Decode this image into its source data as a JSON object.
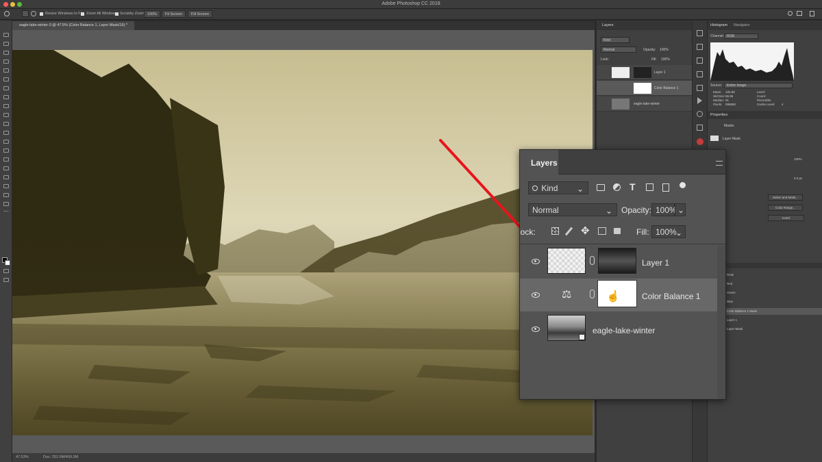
{
  "app": {
    "title": "Adobe Photoshop CC 2018"
  },
  "options_bar": {
    "resize_windows": "Resize Windows to Fit",
    "zoom_all": "Zoom All Windows",
    "scrubby_zoom": "Scrubby Zoom",
    "zoom_100": "100%",
    "fit_screen": "Fit Screen",
    "fill_screen": "Fill Screen"
  },
  "document": {
    "tab_label": "eagle-lake-winter-3 @ 47.5% (Color Balance 1, Layer Mask/16) *",
    "zoom": "47.53%",
    "doc_info": "Doc: 252.9M/409.3M"
  },
  "layers_panel": {
    "title": "Layers",
    "filter": "Kind",
    "blend_mode": "Normal",
    "opacity_label": "Opacity:",
    "opacity_value": "100%",
    "lock_label": "Lock:",
    "fill_label": "Fill:",
    "fill_value": "100%",
    "layers": [
      {
        "name": "Layer 1"
      },
      {
        "name": "Color Balance 1"
      },
      {
        "name": "eagle-lake-winter"
      }
    ]
  },
  "histogram_panel": {
    "tabs": [
      "Histogram",
      "Navigator"
    ],
    "channel_label": "Channel:",
    "channel_value": "RGB",
    "source_label": "Source:",
    "source_value": "Entire Image",
    "stats_left": [
      "Mean:",
      "Std Dev:",
      "Median:",
      "Pixels:"
    ],
    "stats_values": [
      "100.88",
      "66.95",
      "91",
      "995850"
    ],
    "stats_right": [
      "Level:",
      "Count:",
      "Percentile:",
      "Cache Level:"
    ],
    "cache_level": "4"
  },
  "properties_panel": {
    "title": "Properties",
    "masks": "Masks",
    "layer_mask": "Layer Mask",
    "density": "100%",
    "feather": "0.0 px",
    "select_and_mask": "Select and Mask...",
    "color_range": "Color Range...",
    "invert": "Invert"
  },
  "history_panel": {
    "items": [
      "RGB",
      "Red",
      "Green",
      "Blue",
      "Color Balance 1 Mask",
      "Layer 1",
      "Layer Mask"
    ]
  },
  "colors": {
    "arrow": "#e8141c",
    "sepia_light": "#e3dcba",
    "sepia_dark": "#2f2a12"
  }
}
